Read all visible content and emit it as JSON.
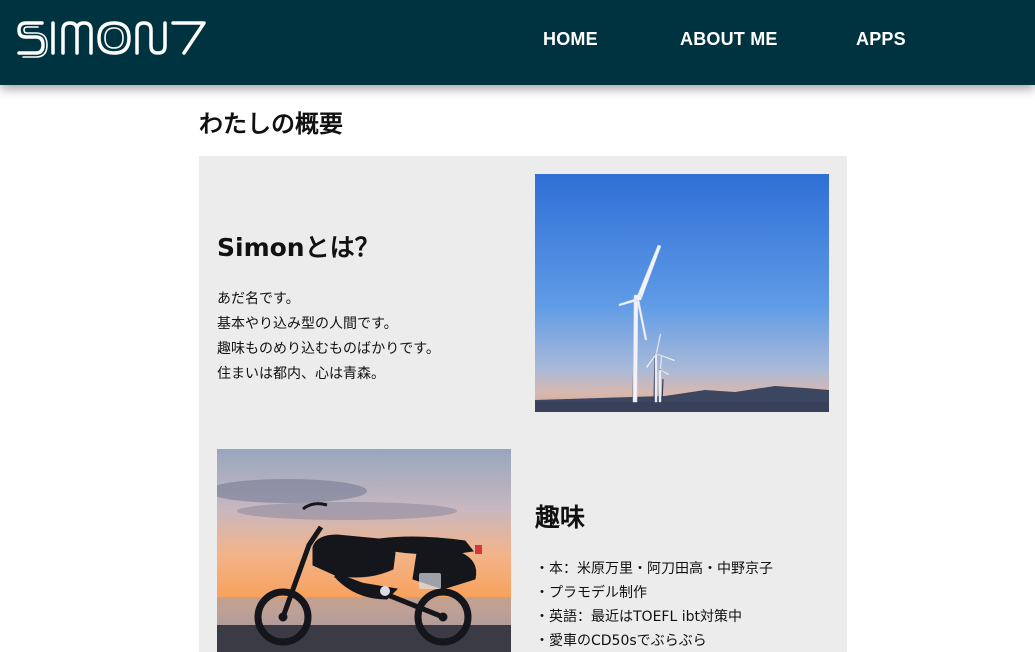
{
  "header": {
    "logo_text": "SIMON7",
    "nav": [
      {
        "label": "HOME"
      },
      {
        "label": "ABOUT ME"
      },
      {
        "label": "APPS"
      }
    ]
  },
  "main": {
    "page_title": "わたしの概要",
    "about": {
      "heading": "Simonとは？",
      "lines": [
        "あだ名です。",
        "基本やり込み型の人間です。",
        "趣味ものめり込むものばかりです。",
        "住まいは都内、心は青森。"
      ]
    },
    "hobby": {
      "heading": "趣味",
      "items": [
        "・本：米原万里・阿刀田高・中野京子",
        "・プラモデル制作",
        "・英語：最近はTOEFL ibt対策中",
        "・愛車のCD50sでぶらぶら"
      ]
    }
  },
  "colors": {
    "header_bg": "#003340",
    "panel_bg": "#ececec",
    "nav_text": "#ffffff"
  }
}
